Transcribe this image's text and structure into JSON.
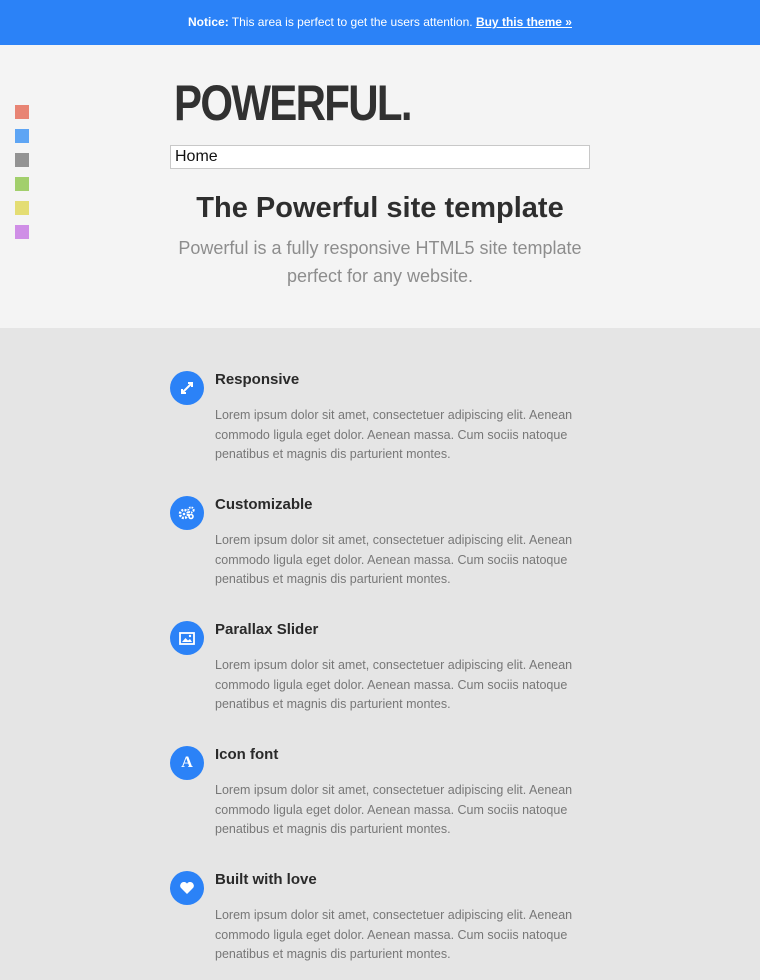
{
  "notice": {
    "label": "Notice:",
    "text": " This area is perfect to get the users attention. ",
    "link": "Buy this theme »"
  },
  "swatches": [
    "#e88474",
    "#5ea5f4",
    "#939393",
    "#a2cf6c",
    "#e4dd73",
    "#cf8ee6"
  ],
  "header": {
    "logo": "POWERFUL.",
    "nav_value": "Home",
    "title": "The Powerful site template",
    "subtitle": "Powerful is a fully responsive HTML5 site template perfect for any website."
  },
  "features": [
    {
      "title": "Responsive",
      "icon": "resize-icon",
      "text": "Lorem ipsum dolor sit amet, consectetuer adipiscing elit. Aenean commodo ligula eget dolor. Aenean massa. Cum sociis natoque penatibus et magnis dis parturient montes."
    },
    {
      "title": "Customizable",
      "icon": "gears-icon",
      "text": "Lorem ipsum dolor sit amet, consectetuer adipiscing elit. Aenean commodo ligula eget dolor. Aenean massa. Cum sociis natoque penatibus et magnis dis parturient montes."
    },
    {
      "title": "Parallax Slider",
      "icon": "picture-icon",
      "text": "Lorem ipsum dolor sit amet, consectetuer adipiscing elit. Aenean commodo ligula eget dolor. Aenean massa. Cum sociis natoque penatibus et magnis dis parturient montes."
    },
    {
      "title": "Icon font",
      "icon": "font-icon",
      "glyph": "A",
      "text": "Lorem ipsum dolor sit amet, consectetuer adipiscing elit. Aenean commodo ligula eget dolor. Aenean massa. Cum sociis natoque penatibus et magnis dis parturient montes."
    },
    {
      "title": "Built with love",
      "icon": "heart-icon",
      "text": "Lorem ipsum dolor sit amet, consectetuer adipiscing elit. Aenean commodo ligula eget dolor. Aenean massa. Cum sociis natoque penatibus et magnis dis parturient montes."
    }
  ],
  "colors": {
    "accent": "#2b82f7",
    "header_bg": "#f4f4f4",
    "body_bg": "#e5e5e5"
  }
}
